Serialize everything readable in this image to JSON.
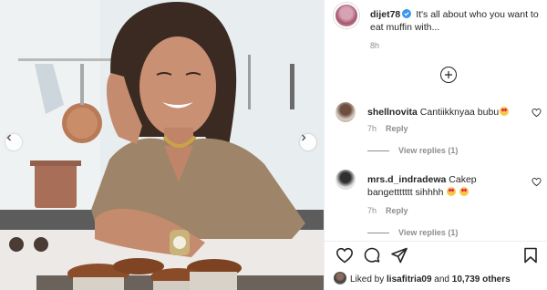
{
  "post": {
    "author": "dijet78",
    "caption": "It's all about who you want to eat muffin with...",
    "time": "8h"
  },
  "comments": [
    {
      "username": "shellnovita",
      "text": "Cantiikknyaa bubu",
      "emoji": "heart-eyes-emoji",
      "time": "7h",
      "reply_label": "Reply",
      "view_replies": "View replies (1)"
    },
    {
      "username": "mrs.d_indradewa",
      "text": "Cakep bangettttttt sihhhh",
      "emoji": "heart-eyes-emoji",
      "time": "7h",
      "reply_label": "Reply",
      "view_replies": "View replies (1)"
    }
  ],
  "likes": {
    "prefix": "Liked by",
    "user": "lisafitria09",
    "conjunction": "and",
    "others": "10,739 others"
  },
  "icons": {
    "verified": "verified-badge-icon",
    "like": "heart-icon",
    "comment": "comment-bubble-icon",
    "share": "paper-plane-icon",
    "save": "bookmark-icon",
    "load_more": "plus-circle-icon"
  },
  "colors": {
    "verified": "#3897f0",
    "text": "#262626",
    "muted": "#8e8e8e"
  }
}
